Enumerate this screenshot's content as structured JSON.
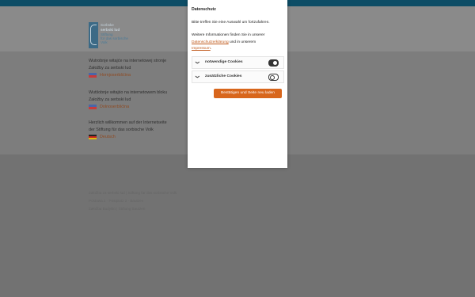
{
  "site": {
    "logo": {
      "line1": "Sorbske",
      "line2": "serbski lud",
      "line3": "Stiftung",
      "line4": "für das sorbische",
      "line5": "Volk"
    },
    "languages": [
      {
        "text_line1": "Wutrobnje witajće na internetowej stronje",
        "text_line2": "Załožby za serbski lud",
        "link": "Hornjoserbšćina",
        "flag_colors": [
          "#4a66a8",
          "#c83b3b"
        ]
      },
      {
        "text_line1": "Wutšobnje witajśo na internetowem bloku",
        "text_line2": "Załožby za serbski lud",
        "link": "Dolnoserbšćina",
        "flag_colors": [
          "#4a66a8",
          "#c83b3b"
        ]
      },
      {
        "text_line1": "Herzlich willkommen auf der Internetseite",
        "text_line2": "der Stiftung für das sorbische Volk",
        "link": "Deutsch",
        "flag_colors": [
          "#222222",
          "#c8281e",
          "#e0b810"
        ]
      }
    ],
    "footer": {
      "line1": "Załožba za serbski lud | Stiftung für das sorbische Volk",
      "line2": "Postowa 2 · Postplatz 2 · Bautzen",
      "line3": "Załožba Budyšin | Stiftung Bautzen"
    }
  },
  "cookie_modal": {
    "title": "Datenschutz",
    "intro": "Bitte treffen Sie eine Auswahl um fortzufahren.",
    "info_prefix": "Weitere Informationen finden Sie in unserer",
    "privacy_link": "Datenschutzerklärung",
    "info_middle": "und in unserem",
    "imprint_link": "Impressum",
    "info_suffix": ".",
    "categories": [
      {
        "label": "notwendige Cookies",
        "enabled": true
      },
      {
        "label": "zusätzliche Cookies",
        "enabled": false
      }
    ],
    "save_button": "Bestätigen und Seite neu laden",
    "accent_color": "#d8661c"
  }
}
